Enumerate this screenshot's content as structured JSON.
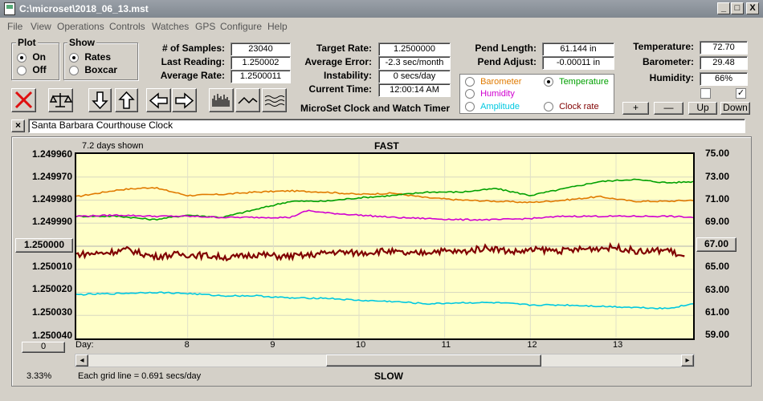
{
  "window": {
    "title": "C:\\microset\\2018_06_13.mst",
    "minimize": "_",
    "maximize": "□",
    "close": "X"
  },
  "menu": [
    "File",
    "View",
    "Operations",
    "Controls",
    "Watches",
    "GPS",
    "Configure",
    "Help"
  ],
  "plot_group": {
    "label": "Plot",
    "on": "On",
    "off": "Off",
    "selected": "On"
  },
  "show_group": {
    "label": "Show",
    "rates": "Rates",
    "boxcar": "Boxcar",
    "selected": "Rates"
  },
  "stats": {
    "samples_label": "# of Samples:",
    "samples": "23040",
    "last_reading_label": "Last Reading:",
    "last_reading": "1.250002",
    "average_rate_label": "Average Rate:",
    "average_rate": "1.2500011"
  },
  "rates": {
    "target_rate_label": "Target Rate:",
    "target_rate": "1.2500000",
    "average_error_label": "Average Error:",
    "average_error": "-2.3 sec/month",
    "instability_label": "Instability:",
    "instability": "0 secs/day",
    "current_time_label": "Current Time:",
    "current_time": "12:00:14 AM"
  },
  "app_caption": "MicroSet Clock and Watch Timer",
  "pendulum": {
    "length_label": "Pend Length:",
    "length": "61.144 in",
    "adjust_label": "Pend Adjust:",
    "adjust": "-0.00011 in"
  },
  "sensor_select": {
    "barometer": "Barometer",
    "temperature": "Temperature",
    "humidity": "Humidity",
    "amplitude": "Amplitude",
    "clock_rate": "Clock rate",
    "selected": "Temperature",
    "colors": {
      "barometer": "#e07a00",
      "temperature": "#00a000",
      "humidity": "#d000d0",
      "amplitude": "#00c8e0",
      "clock_rate": "#800000"
    }
  },
  "environment": {
    "temperature_label": "Temperature:",
    "temperature": "72.70",
    "barometer_label": "Barometer:",
    "barometer": "29.48",
    "humidity_label": "Humidity:",
    "humidity": "66%",
    "checkbox1_checked": false,
    "checkbox2_checked": true,
    "checkbox2_mark": "✓"
  },
  "scale_buttons": {
    "plus": "+",
    "minus": "—",
    "up": "Up",
    "down": "Down"
  },
  "toolbar_icons": [
    "clear-icon",
    "balance-icon",
    "arrow-down-icon",
    "arrow-up-icon",
    "arrow-left-icon",
    "arrow-right-icon",
    "bars-view-icon",
    "wave-view-icon",
    "multi-wave-icon"
  ],
  "clock_name": {
    "close": "×",
    "value": "Santa Barbara Courthouse Clock"
  },
  "chart_header": {
    "days_shown": "7.2 days shown",
    "fast": "FAST",
    "slow": "SLOW"
  },
  "chart_footer": {
    "percent": "3.33%",
    "grid_note": "Each grid line = 0.691 secs/day",
    "day_label": "Day:",
    "left_zero_button": "0"
  },
  "left_axis": [
    "1.249960",
    "1.249970",
    "1.249980",
    "1.249990",
    "1.250000",
    "1.250010",
    "1.250020",
    "1.250030",
    "1.250040"
  ],
  "right_axis": [
    "75.00",
    "73.00",
    "71.00",
    "69.00",
    "67.00",
    "65.00",
    "63.00",
    "61.00",
    "59.00"
  ],
  "center_left_button": "1.250000",
  "center_right_button": "67.00",
  "scrollbar": {
    "left_arrow": "◂",
    "right_arrow": "▸",
    "thumb_position": 0.53
  },
  "chart_data": {
    "type": "line",
    "x_label": "Day:",
    "x_ticks": [
      "8",
      "9",
      "10",
      "11",
      "12",
      "13"
    ],
    "x_range": [
      6.7,
      13.9
    ],
    "left_axis": {
      "ylim": [
        1.24996,
        1.25004
      ],
      "unit": "rate",
      "inverted": true
    },
    "right_axis": {
      "ylim": [
        59,
        75
      ],
      "unit": "temperature"
    },
    "grid": true,
    "series": [
      {
        "color": "#e07a00",
        "axis": "right",
        "x": [
          6.7,
          7.2,
          7.6,
          8.0,
          8.4,
          8.8,
          9.2,
          9.6,
          10.0,
          10.4,
          10.8,
          11.2,
          11.6,
          12.0,
          12.4,
          12.8,
          13.2,
          13.6,
          13.9
        ],
        "values": [
          71.3,
          71.9,
          72.1,
          71.4,
          71.5,
          71.7,
          71.8,
          71.7,
          71.5,
          71.6,
          71.2,
          71.0,
          70.9,
          70.8,
          71.0,
          71.3,
          70.9,
          70.9,
          71.0
        ]
      },
      {
        "color": "#00a000",
        "axis": "right",
        "x": [
          6.7,
          7.2,
          7.6,
          8.0,
          8.4,
          8.8,
          9.2,
          9.6,
          10.0,
          10.4,
          10.8,
          11.2,
          11.6,
          12.0,
          12.4,
          12.8,
          13.2,
          13.6,
          13.9
        ],
        "values": [
          69.6,
          69.6,
          69.3,
          69.7,
          69.5,
          70.2,
          70.9,
          70.9,
          71.2,
          71.4,
          71.7,
          71.7,
          72.0,
          71.4,
          72.0,
          72.6,
          72.8,
          72.5,
          72.6
        ]
      },
      {
        "color": "#d000d0",
        "axis": "right",
        "x": [
          6.7,
          7.2,
          7.6,
          8.0,
          8.4,
          8.8,
          9.2,
          9.4,
          9.6,
          10.0,
          10.4,
          10.8,
          11.2,
          11.6,
          12.0,
          12.4,
          12.8,
          13.2,
          13.6,
          13.9
        ],
        "values": [
          69.6,
          69.7,
          69.6,
          69.6,
          69.5,
          69.5,
          69.5,
          70.1,
          69.9,
          69.7,
          69.5,
          69.4,
          69.3,
          69.3,
          69.4,
          69.6,
          69.6,
          69.6,
          69.6,
          69.5
        ]
      },
      {
        "color": "#800000",
        "axis": "right",
        "x": [
          6.7,
          7.0,
          7.3,
          7.6,
          7.9,
          8.2,
          8.5,
          8.8,
          9.1,
          9.4,
          9.7,
          10.0,
          10.3,
          10.6,
          10.9,
          11.2,
          11.5,
          11.8,
          12.1,
          12.4,
          12.7,
          13.0,
          13.3,
          13.6,
          13.8
        ],
        "values": [
          66.3,
          66.4,
          66.7,
          66.1,
          66.3,
          66.2,
          66.0,
          66.3,
          66.1,
          66.2,
          66.5,
          66.4,
          66.6,
          66.3,
          66.6,
          66.5,
          66.9,
          66.5,
          66.7,
          66.6,
          66.8,
          66.9,
          66.5,
          66.7,
          66.0
        ]
      },
      {
        "color": "#00c8e0",
        "axis": "right",
        "x": [
          6.7,
          7.2,
          7.6,
          8.0,
          8.4,
          8.8,
          9.2,
          9.6,
          10.0,
          10.4,
          10.8,
          11.2,
          11.6,
          12.0,
          12.4,
          12.8,
          13.2,
          13.6,
          13.9
        ],
        "values": [
          62.8,
          62.9,
          63.0,
          62.9,
          62.7,
          62.7,
          62.5,
          62.5,
          62.3,
          62.2,
          62.0,
          62.1,
          62.1,
          61.9,
          61.9,
          61.8,
          61.7,
          61.6,
          62.0
        ]
      }
    ]
  }
}
